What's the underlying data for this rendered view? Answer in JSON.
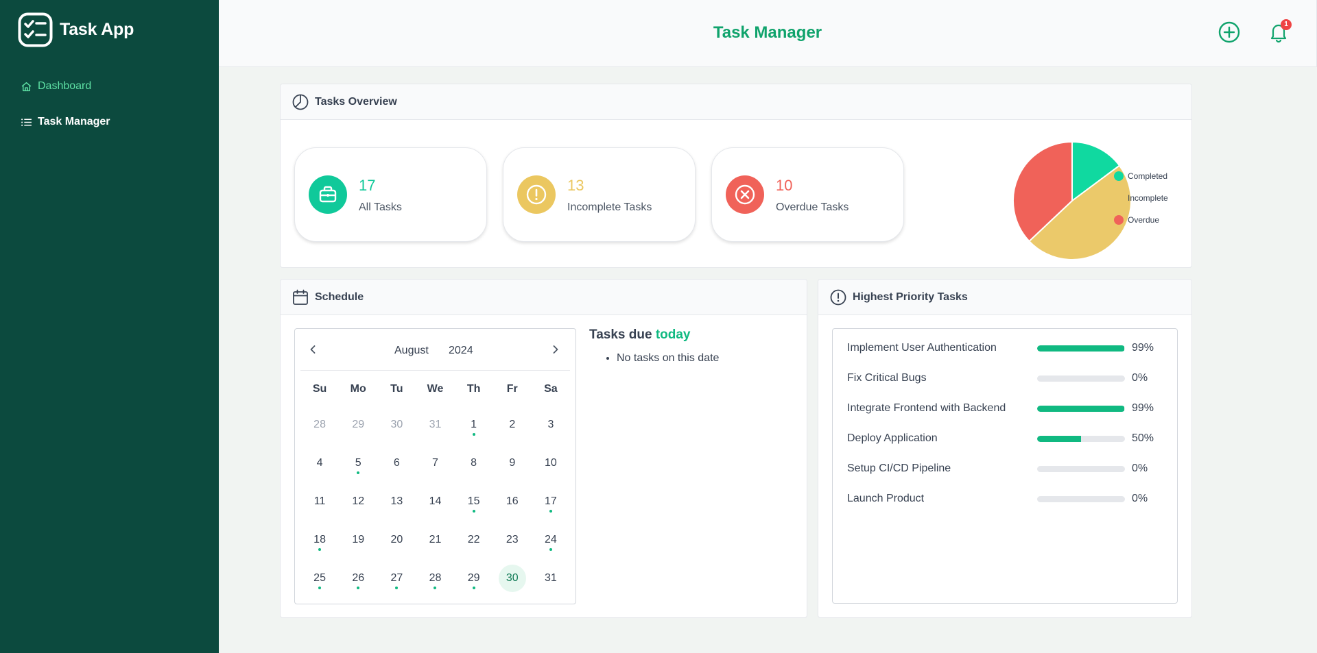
{
  "sidebar": {
    "brand": "Task App",
    "items": [
      {
        "label": "Dashboard",
        "icon": "home-icon",
        "active": true
      },
      {
        "label": "Task Manager",
        "icon": "list-icon",
        "active": false
      }
    ]
  },
  "header": {
    "title": "Task Manager",
    "notification_count": "1"
  },
  "overview": {
    "title": "Tasks Overview",
    "cards": [
      {
        "value": "17",
        "label": "All Tasks",
        "color": "#10c99a",
        "icon": "briefcase-icon"
      },
      {
        "value": "13",
        "label": "Incomplete Tasks",
        "color": "#ebc760",
        "icon": "exclamation-icon"
      },
      {
        "value": "10",
        "label": "Overdue Tasks",
        "color": "#f06259",
        "icon": "x-circle-icon"
      }
    ],
    "legend": [
      {
        "label": "Completed",
        "color": "#10d9a0"
      },
      {
        "label": "Incomplete",
        "color": "#ebc96a"
      },
      {
        "label": "Overdue",
        "color": "#f06259"
      }
    ]
  },
  "chart_data": {
    "type": "pie",
    "categories": [
      "Completed",
      "Incomplete",
      "Overdue"
    ],
    "values": [
      4,
      13,
      10
    ],
    "colors": [
      "#10d9a0",
      "#ebc96a",
      "#f06259"
    ],
    "legend_position": "right"
  },
  "schedule": {
    "title": "Schedule",
    "month": "August",
    "year": "2024",
    "weekdays": [
      "Su",
      "Mo",
      "Tu",
      "We",
      "Th",
      "Fr",
      "Sa"
    ],
    "days": [
      {
        "d": "28",
        "muted": true
      },
      {
        "d": "29",
        "muted": true
      },
      {
        "d": "30",
        "muted": true
      },
      {
        "d": "31",
        "muted": true
      },
      {
        "d": "1",
        "dot": true
      },
      {
        "d": "2"
      },
      {
        "d": "3"
      },
      {
        "d": "4"
      },
      {
        "d": "5",
        "dot": true
      },
      {
        "d": "6"
      },
      {
        "d": "7"
      },
      {
        "d": "8"
      },
      {
        "d": "9"
      },
      {
        "d": "10"
      },
      {
        "d": "11"
      },
      {
        "d": "12"
      },
      {
        "d": "13"
      },
      {
        "d": "14"
      },
      {
        "d": "15",
        "dot": true
      },
      {
        "d": "16"
      },
      {
        "d": "17",
        "dot": true
      },
      {
        "d": "18",
        "dot": true
      },
      {
        "d": "19"
      },
      {
        "d": "20"
      },
      {
        "d": "21"
      },
      {
        "d": "22"
      },
      {
        "d": "23"
      },
      {
        "d": "24",
        "dot": true
      },
      {
        "d": "25",
        "dot": true
      },
      {
        "d": "26",
        "dot": true
      },
      {
        "d": "27",
        "dot": true
      },
      {
        "d": "28",
        "dot": true
      },
      {
        "d": "29",
        "dot": true
      },
      {
        "d": "30",
        "selected": true
      },
      {
        "d": "31"
      }
    ],
    "due_title": "Tasks due",
    "due_highlight": "today",
    "due_items": [
      "No tasks on this date"
    ]
  },
  "priority": {
    "title": "Highest Priority Tasks",
    "tasks": [
      {
        "name": "Implement User Authentication",
        "progress": 99,
        "label": "99%"
      },
      {
        "name": "Fix Critical Bugs",
        "progress": 0,
        "label": "0%"
      },
      {
        "name": "Integrate Frontend with Backend",
        "progress": 99,
        "label": "99%"
      },
      {
        "name": "Deploy Application",
        "progress": 50,
        "label": "50%"
      },
      {
        "name": "Setup CI/CD Pipeline",
        "progress": 0,
        "label": "0%"
      },
      {
        "name": "Launch Product",
        "progress": 0,
        "label": "0%"
      }
    ]
  }
}
